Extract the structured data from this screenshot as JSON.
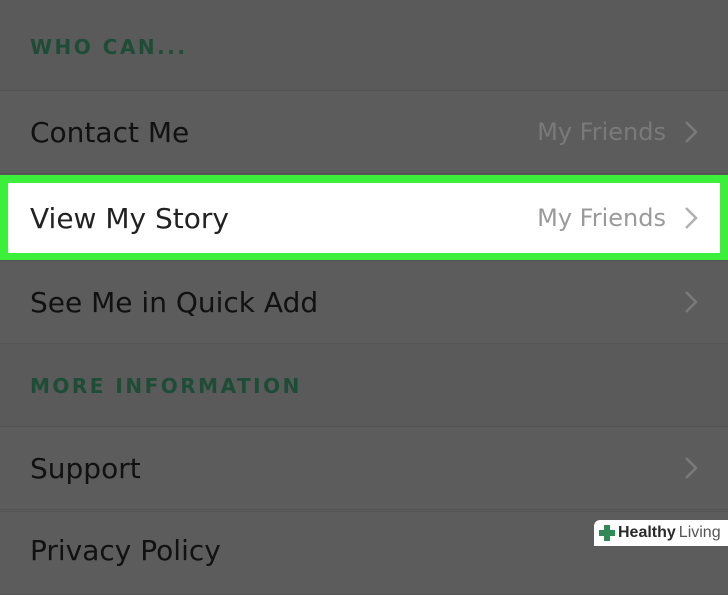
{
  "sections": {
    "who_can": "WHO CAN...",
    "more_information": "MORE INFORMATION"
  },
  "rows": {
    "contact_me": {
      "label": "Contact Me",
      "value": "My Friends"
    },
    "view_my_story": {
      "label": "View My Story",
      "value": "My Friends"
    },
    "quick_add": {
      "label": "See Me in Quick Add"
    },
    "support": {
      "label": "Support"
    },
    "privacy_policy": {
      "label": "Privacy Policy"
    }
  },
  "watermark": {
    "brand_word1": "Healthy",
    "brand_word2": "Living"
  },
  "colors": {
    "highlight_border": "#3bef3b",
    "section_header_text": "#1e4d37",
    "background": "#5a5a5a"
  },
  "icons": {
    "chevron": "chevron-right-icon",
    "brand": "plus-cross-icon"
  }
}
